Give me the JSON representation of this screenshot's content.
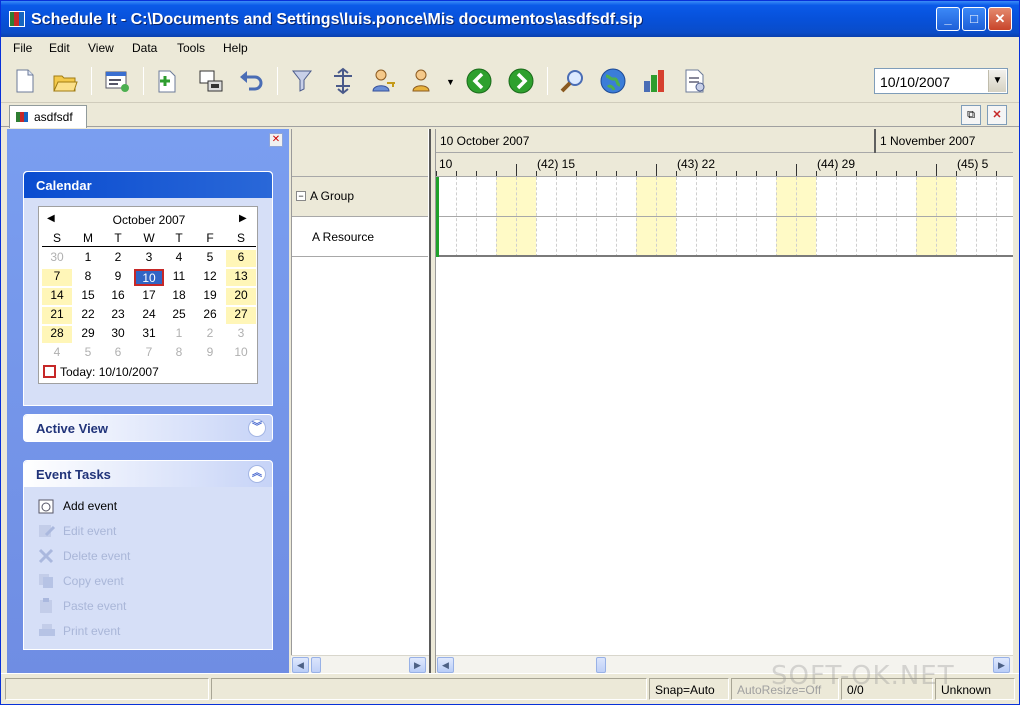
{
  "window": {
    "title": "Schedule It - C:\\Documents and Settings\\luis.ponce\\Mis documentos\\asdfsdf.sip"
  },
  "menu": [
    "File",
    "Edit",
    "View",
    "Data",
    "Tools",
    "Help"
  ],
  "toolbar": {
    "date_value": "10/10/2007",
    "icons": [
      "new-file-icon",
      "open-folder-icon",
      "properties-icon",
      "add-page-icon",
      "import-icon",
      "undo-icon",
      "filter-icon",
      "align-icon",
      "user-key-icon",
      "user-search-icon",
      "back-arrow-icon",
      "forward-arrow-icon",
      "zoom-icon",
      "globe-icon",
      "bar-chart-icon",
      "print-preview-icon"
    ]
  },
  "doc_tab": {
    "label": "asdfsdf"
  },
  "calendar_panel": {
    "title": "Calendar",
    "month": "October 2007",
    "dow": [
      "S",
      "M",
      "T",
      "W",
      "T",
      "F",
      "S"
    ],
    "weeks": [
      [
        "30",
        "1",
        "2",
        "3",
        "4",
        "5",
        "6"
      ],
      [
        "7",
        "8",
        "9",
        "10",
        "11",
        "12",
        "13"
      ],
      [
        "14",
        "15",
        "16",
        "17",
        "18",
        "19",
        "20"
      ],
      [
        "21",
        "22",
        "23",
        "24",
        "25",
        "26",
        "27"
      ],
      [
        "28",
        "29",
        "30",
        "31",
        "1",
        "2",
        "3"
      ],
      [
        "4",
        "5",
        "6",
        "7",
        "8",
        "9",
        "10"
      ]
    ],
    "selected": "10",
    "today_label": "Today: 10/10/2007"
  },
  "active_view": {
    "title": "Active View"
  },
  "event_tasks": {
    "title": "Event Tasks",
    "items": [
      {
        "label": "Add event",
        "enabled": true
      },
      {
        "label": "Edit event",
        "enabled": false
      },
      {
        "label": "Delete event",
        "enabled": false
      },
      {
        "label": "Copy event",
        "enabled": false
      },
      {
        "label": "Paste event",
        "enabled": false
      },
      {
        "label": "Print event",
        "enabled": false
      }
    ]
  },
  "resources": {
    "group": "A Group",
    "expander": "−",
    "item": "A Resource"
  },
  "timeline": {
    "month1": "10 October 2007",
    "month2": "1 November 2007",
    "scale": [
      "10",
      "(42) 15",
      "(43) 22",
      "(44) 29",
      "(45) 5"
    ]
  },
  "statusbar": {
    "snap": "Snap=Auto",
    "autoresize": "AutoResize=Off",
    "count": "0/0",
    "state": "Unknown"
  },
  "watermark": "SOFT-OK.NET"
}
